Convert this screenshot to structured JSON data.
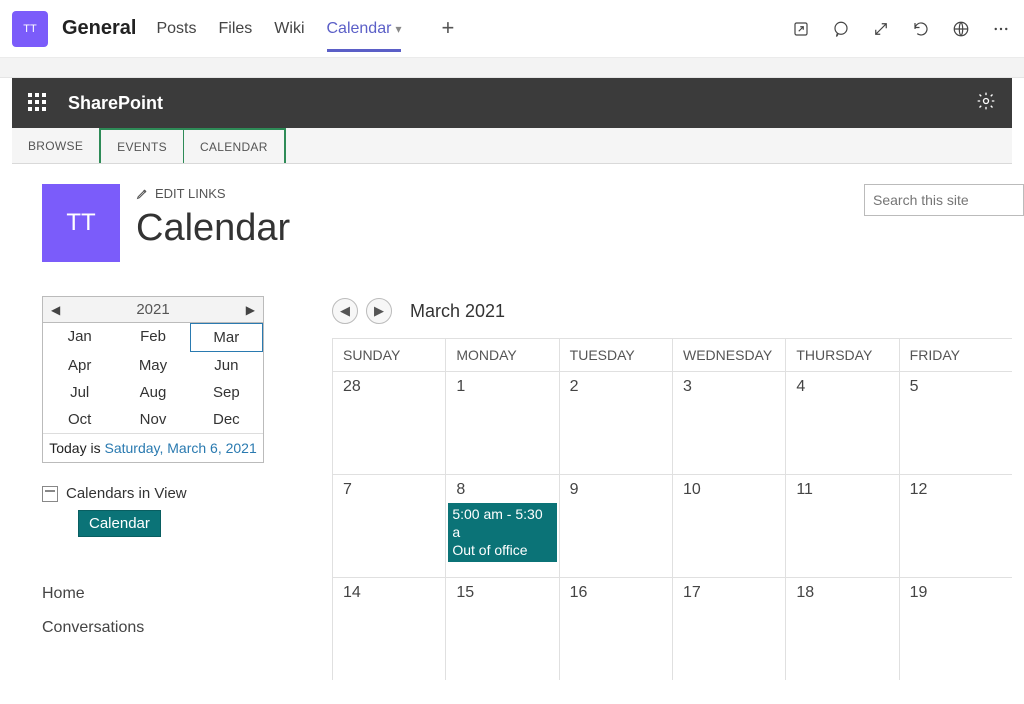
{
  "teams": {
    "avatar": "TT",
    "channel": "General",
    "tabs": [
      "Posts",
      "Files",
      "Wiki",
      "Calendar"
    ],
    "activeTab": "Calendar"
  },
  "sharepoint": {
    "title": "SharePoint"
  },
  "ribbon": {
    "browse": "BROWSE",
    "events": "EVENTS",
    "calendar": "CALENDAR"
  },
  "page": {
    "avatar": "TT",
    "editLinks": "EDIT LINKS",
    "title": "Calendar",
    "search_placeholder": "Search this site"
  },
  "miniCal": {
    "year": "2021",
    "months": [
      "Jan",
      "Feb",
      "Mar",
      "Apr",
      "May",
      "Jun",
      "Jul",
      "Aug",
      "Sep",
      "Oct",
      "Nov",
      "Dec"
    ],
    "currentIndex": 2,
    "todayPrefix": "Today is ",
    "todayLink": "Saturday, March 6, 2021"
  },
  "calendarsInView": {
    "label": "Calendars in View",
    "badge": "Calendar"
  },
  "quickLinks": [
    "Home",
    "Conversations"
  ],
  "monthNav": {
    "label": "March 2021"
  },
  "dow": [
    "SUNDAY",
    "MONDAY",
    "TUESDAY",
    "WEDNESDAY",
    "THURSDAY",
    "FRIDAY"
  ],
  "weeks": [
    [
      "28",
      "1",
      "2",
      "3",
      "4",
      "5"
    ],
    [
      "7",
      "8",
      "9",
      "10",
      "11",
      "12"
    ],
    [
      "14",
      "15",
      "16",
      "17",
      "18",
      "19"
    ]
  ],
  "event": {
    "dayRow": 1,
    "dayCol": 1,
    "time": "5:00 am - 5:30 a",
    "title": "Out of office"
  }
}
